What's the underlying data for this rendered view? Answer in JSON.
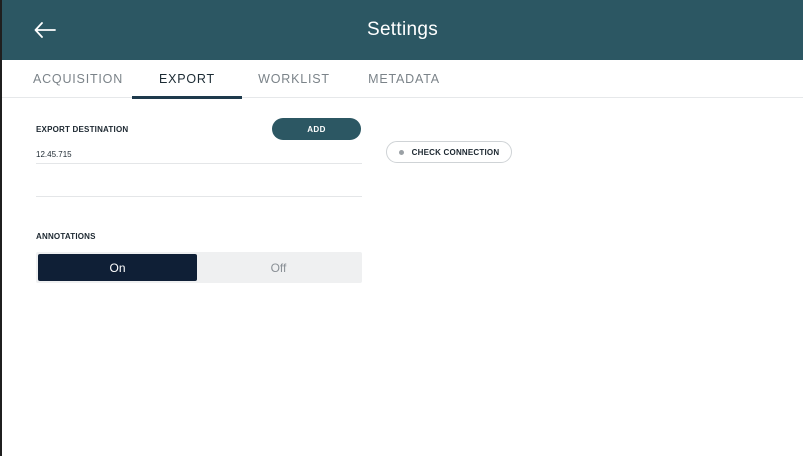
{
  "header": {
    "title": "Settings",
    "back_icon": "arrow-left-icon",
    "background_color": "#2c5763"
  },
  "tabs": [
    {
      "label": "ACQUISITION",
      "active": false
    },
    {
      "label": "EXPORT",
      "active": true
    },
    {
      "label": "WORKLIST",
      "active": false
    },
    {
      "label": "METADATA",
      "active": false
    }
  ],
  "export": {
    "section_label": "EXPORT DESTINATION",
    "add_label": "ADD",
    "destination_value": "12.45.715",
    "check_connection_label": "CHECK CONNECTION",
    "connection_status_color": "#9aa0a5"
  },
  "annotations": {
    "section_label": "ANNOTATIONS",
    "options": [
      "On",
      "Off"
    ],
    "selected": "On",
    "selected_color": "#0f1f36"
  }
}
